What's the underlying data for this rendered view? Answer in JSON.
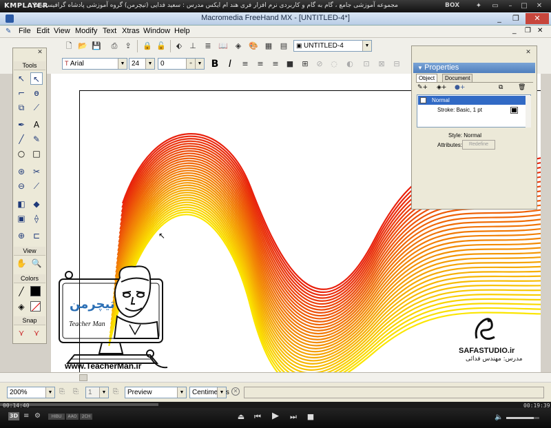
{
  "player": {
    "brand": "KMPLAYER",
    "title": "مجموعه آموزشی جامع ، گام به گام و کاربردی نرم افزار فری هند ام ایکس  مدرس : سعید فدایی (تیچرمن) گروه آموزشی پادشاه گرافیست ها",
    "box_label": "BOX",
    "time_elapsed": "00:14:40",
    "time_total": "00:19:39",
    "badge_3d": "3D",
    "mode_labels": [
      "HIBU",
      "AAO",
      "2CH"
    ],
    "progress_fraction": 0.287,
    "volume_fraction": 0.83
  },
  "app": {
    "title": "Macromedia FreeHand MX - [UNTITLED-4*]",
    "menus": [
      "File",
      "Edit",
      "View",
      "Modify",
      "Text",
      "Xtras",
      "Window",
      "Help"
    ],
    "document_combo": "UNTITLED-4",
    "font_name": "Arial",
    "font_size": "24",
    "tracking": "0"
  },
  "tools_panel": {
    "sections": [
      "Tools",
      "View",
      "Colors",
      "Snap"
    ]
  },
  "properties": {
    "title": "Properties",
    "tabs": [
      "Object",
      "Document"
    ],
    "items": [
      "Normal",
      "Stroke: Basic, 1 pt"
    ],
    "style_label": "Style: Normal",
    "attributes_label": "Attributes:",
    "redefine_button": "Redefine"
  },
  "statusbar": {
    "zoom": "200%",
    "page": "1",
    "view_mode": "Preview",
    "units": "Centimeters"
  },
  "watermarks": {
    "teacherman_url": "www.TeacherMan.ir",
    "teacherman_name": "Teacher Man",
    "teacherman_logo_text": "تیچرمن",
    "safa": "SAFASTUDIO.ir",
    "safa_teacher": "مدرس: مهندس فدائی"
  },
  "colors": {
    "wave_top": "#e8200c",
    "wave_bottom": "#fbe500",
    "selection": "#316ac5"
  }
}
